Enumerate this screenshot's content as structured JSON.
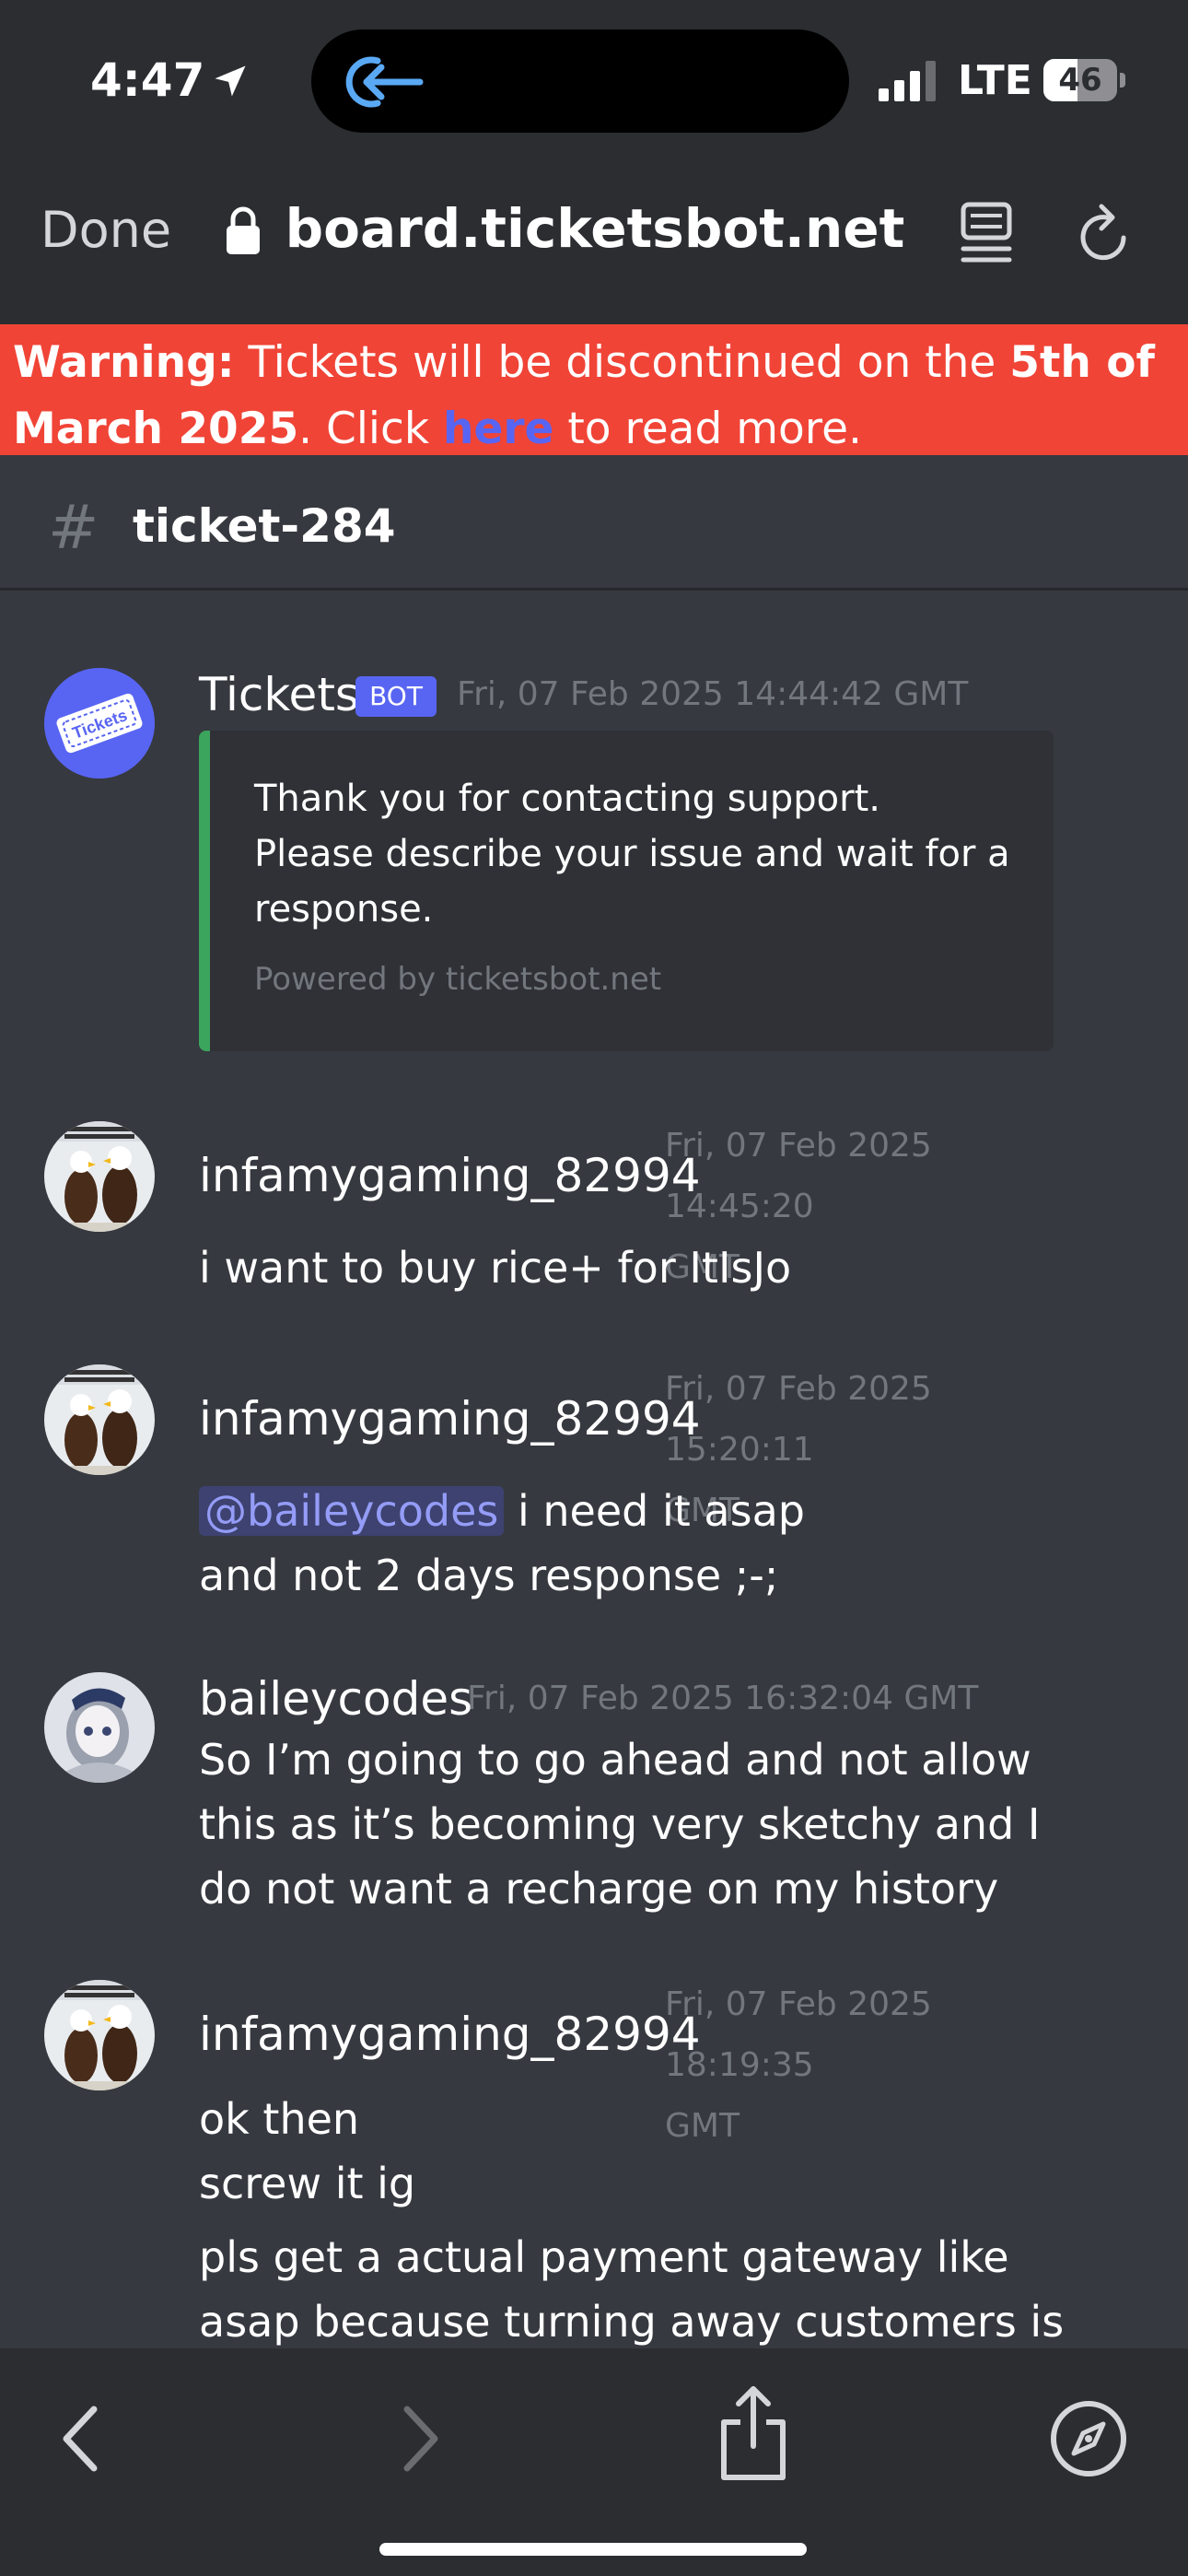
{
  "status_bar": {
    "time": "4:47",
    "network": "LTE",
    "battery_level": "46",
    "battery_fraction": 0.46
  },
  "browser": {
    "done_label": "Done",
    "url": " board.ticketsbot.net"
  },
  "warning": {
    "prefix": "Warning:",
    "text1": " Tickets will be discontinued on the ",
    "date_bold": "5th of March 2025",
    "text2": ". Click ",
    "link": "here",
    "text3": " to read more."
  },
  "channel": {
    "hash": "#",
    "name": "ticket-284"
  },
  "messages": [
    {
      "author": "Tickets",
      "badge": "BOT",
      "timestamp": "Fri, 07 Feb 2025 14:44:42 GMT",
      "embed_line1": "Thank you for contacting support.",
      "embed_line2": "Please describe your issue and wait for a",
      "embed_line3": "response.",
      "embed_footer": "Powered by ticketsbot.net"
    },
    {
      "author": "infamygaming_82994",
      "timestamp_l1": "Fri, 07 Feb 2025 14:45:20",
      "timestamp_l2": "GMT",
      "line1": "i want to buy rice+ for ItIsJo"
    },
    {
      "author": "infamygaming_82994",
      "timestamp_l1": "Fri, 07 Feb 2025 15:20:11",
      "timestamp_l2": "GMT",
      "mention": "@baileycodes",
      "line1_rest": " i need it asap",
      "line2": "and not 2 days response ;-;"
    },
    {
      "author": "baileycodes",
      "timestamp": "Fri, 07 Feb 2025 16:32:04 GMT",
      "line1": "So I’m going to go ahead and not allow",
      "line2": "this as it’s becoming very sketchy and I",
      "line3": "do not want a recharge on my history"
    },
    {
      "author": "infamygaming_82994",
      "timestamp_l1": "Fri, 07 Feb 2025 18:19:35",
      "timestamp_l2": "GMT",
      "line1": "ok then",
      "line2": "screw it ig",
      "line3": "pls get a actual payment gateway like",
      "line4": "asap because turning away customers is"
    }
  ],
  "bot_avatar_label": "Tickets",
  "colors": {
    "background": "#36393f",
    "chrome": "#2b2d31",
    "warning": "#f04437",
    "accent": "#5865f2",
    "embed_bar": "#3ba55d",
    "muted": "#72767d"
  },
  "icons": {
    "location": "location-arrow-icon",
    "island": "arrow-back-circle-icon",
    "lock": "lock-icon",
    "reader": "reader-mode-icon",
    "reload": "reload-icon",
    "back": "chevron-left-icon",
    "forward": "chevron-right-icon",
    "share": "share-icon",
    "safari": "compass-icon"
  }
}
